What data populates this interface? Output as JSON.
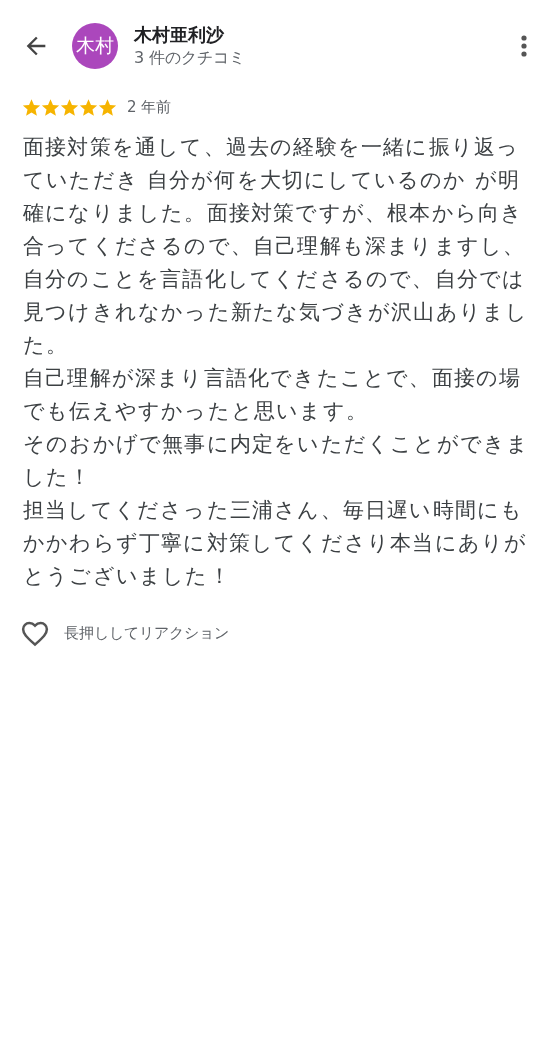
{
  "header": {
    "avatar_text": "木村",
    "name": "木村亜利沙",
    "review_count": "3 件のクチコミ"
  },
  "review": {
    "stars": 5,
    "time": "2 年前",
    "paragraphs": [
      "面接対策を通して、過去の経験を一緒に振り返っていただき 自分が何を大切にしているのか が明確になりました。面接対策ですが、根本から向き合ってくださるので、自己理解も深まりますし、自分のことを言語化してくださるので、自分では見つけきれなかった新たな気づきが沢山ありました。",
      "自己理解が深まり言語化できたことで、面接の場でも伝えやすかったと思います。",
      "そのおかげで無事に内定をいただくことができました！",
      "担当してくださった三浦さん、毎日遅い時間にもかかわらず丁寧に対策してくださり本当にありがとうございました！"
    ]
  },
  "reaction": {
    "label": "長押ししてリアクション"
  }
}
